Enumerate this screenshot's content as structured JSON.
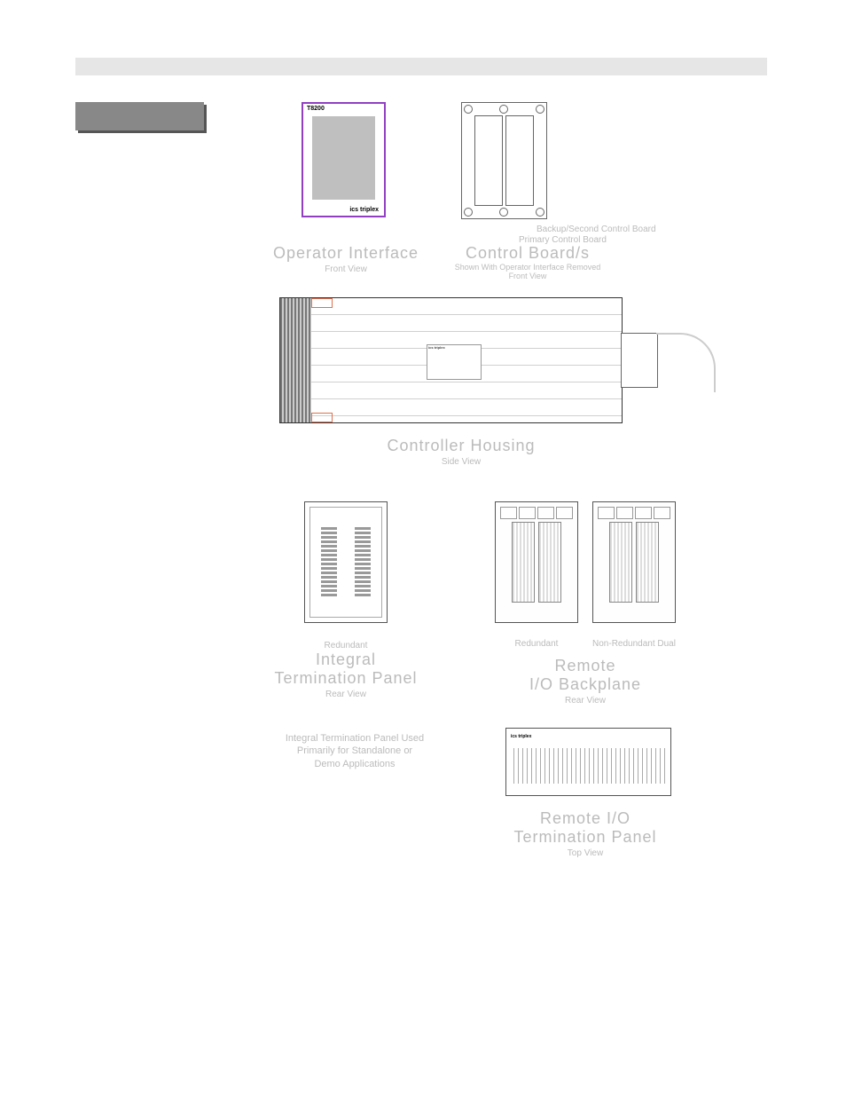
{
  "op_interface": {
    "device_model": "T8200",
    "brand": "ics triplex",
    "title": "Operator Interface",
    "subtitle": "Front View"
  },
  "control_board": {
    "title": "Control Board/s",
    "subtitle1": "Shown With Operator Interface Removed",
    "subtitle2": "Front View",
    "leader1": "Backup/Second Control Board",
    "leader2": "Primary Control Board"
  },
  "housing": {
    "title": "Controller Housing",
    "subtitle": "Side View",
    "plate_brand": "ics triplex"
  },
  "integral": {
    "pre_label": "Redundant",
    "title": "Integral",
    "title2": "Termination Panel",
    "subtitle": "Rear View",
    "note_l1": "Integral Termination Panel Used",
    "note_l2": "Primarily for Standalone or",
    "note_l3": "Demo Applications"
  },
  "remote_bp": {
    "sub_left": "Redundant",
    "sub_right": "Non-Redundant Dual",
    "title": "Remote",
    "title2": "I/O Backplane",
    "subtitle": "Rear View"
  },
  "remote_term": {
    "brand": "ics triplex",
    "title": "Remote I/O",
    "title2": "Termination Panel",
    "subtitle": "Top View"
  }
}
